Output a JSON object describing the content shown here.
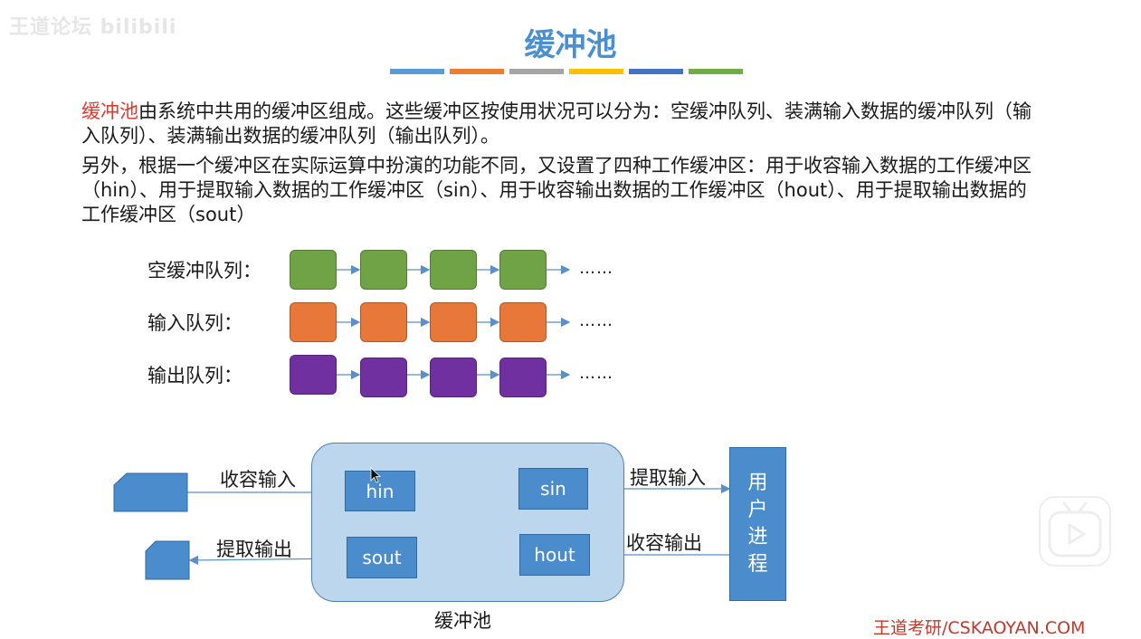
{
  "watermark": {
    "text": "王道论坛 bilibili"
  },
  "slide": {
    "title": "缓冲池",
    "title_bar_colors": [
      "#5b9bd5",
      "#ed7d31",
      "#a5a5a5",
      "#ffc000",
      "#4472c4",
      "#70ad47"
    ]
  },
  "paragraph1": {
    "highlight": "缓冲池",
    "text": "由系统中共用的缓冲区组成。这些缓冲区按使用状况可以分为：空缓冲队列、装满输入数据的缓冲队列（输入队列）、装满输出数据的缓冲队列（输出队列）。"
  },
  "paragraph2": {
    "text": "另外，根据一个缓冲区在实际运算中扮演的功能不同，又设置了四种工作缓冲区：用于收容输入数据的工作缓冲区（hin）、用于提取输入数据的工作缓冲区（sin）、用于收容输出数据的工作缓冲区（hout）、用于提取输出数据的工作缓冲区（sout）"
  },
  "queues": [
    {
      "label": "空缓冲队列：",
      "color": "#70a346",
      "ellipsis": "……"
    },
    {
      "label": "输入队列：",
      "color": "#e8773a",
      "ellipsis": "……"
    },
    {
      "label": "输出队列：",
      "color": "#7030a0",
      "ellipsis": "……"
    }
  ],
  "diagram": {
    "pool_label": "缓冲池",
    "buffers": {
      "hin": "hin",
      "sin": "sin",
      "sout": "sout",
      "hout": "hout"
    },
    "arrows": {
      "collect_input": "收容输入",
      "extract_output": "提取输出",
      "extract_input": "提取输入",
      "collect_output": "收容输出"
    },
    "user_process": "用\n户\n进\n程"
  },
  "brand": {
    "text": "王道考研/CSKAOYAN.COM"
  }
}
